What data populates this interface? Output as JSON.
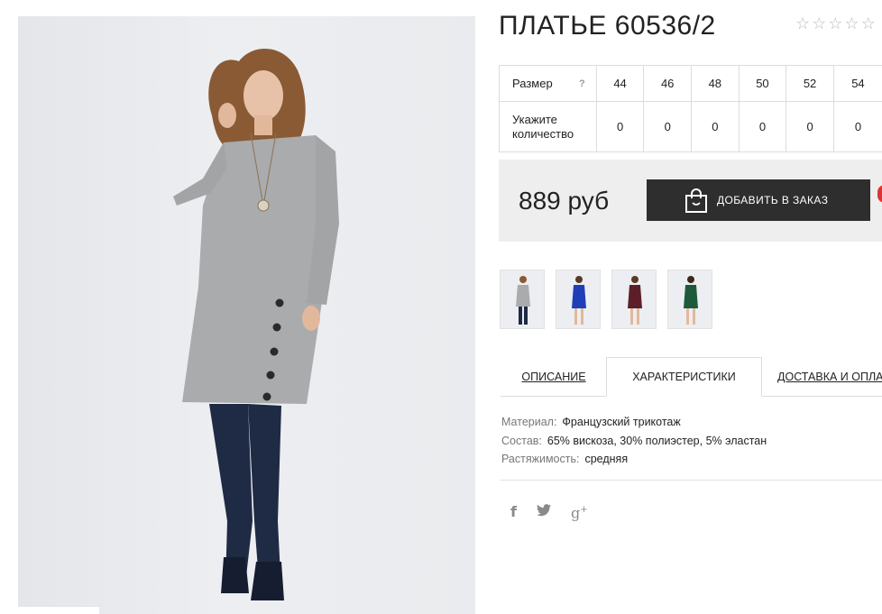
{
  "product": {
    "title": "ПЛАТЬЕ 60536/2",
    "rating": {
      "value": 0,
      "max": 5
    }
  },
  "size_table": {
    "size_label": "Размер",
    "help_icon": "?",
    "quantity_label": "Укажите количество",
    "sizes": [
      "44",
      "46",
      "48",
      "50",
      "52",
      "54"
    ],
    "quantities": [
      "0",
      "0",
      "0",
      "0",
      "0",
      "0"
    ]
  },
  "purchase": {
    "price": "889 руб",
    "add_button_label": "ДОБАВИТЬ В ЗАКАЗ",
    "button_icon": "shopping-bag-icon"
  },
  "thumbnails": [
    {
      "name": "grey-dress",
      "color": "#a9abad"
    },
    {
      "name": "blue-dress",
      "color": "#1f3fb8"
    },
    {
      "name": "burgundy-dress",
      "color": "#5c1f2a"
    },
    {
      "name": "green-dress",
      "color": "#1d5a3c"
    }
  ],
  "tabs": [
    {
      "label": "ОПИСАНИЕ",
      "active": false
    },
    {
      "label": "ХАРАКТЕРИСТИКИ",
      "active": true
    },
    {
      "label": "ДОСТАВКА И ОПЛА",
      "active": false
    }
  ],
  "characteristics": [
    {
      "key": "Материал:",
      "value": "Французский трикотаж"
    },
    {
      "key": "Состав:",
      "value": "65% вискоза, 30% полиэстер, 5% эластан"
    },
    {
      "key": "Растяжимость:",
      "value": "средняя"
    }
  ],
  "social": {
    "facebook": "f",
    "twitter": "🐦",
    "googleplus": "g+"
  },
  "colors": {
    "button_bg": "#2e2e2e",
    "price_box_bg": "#eeeeee",
    "photo_bg": "#e9ebee",
    "dress_grey": "#a9abad",
    "jeans": "#1f2a44"
  }
}
